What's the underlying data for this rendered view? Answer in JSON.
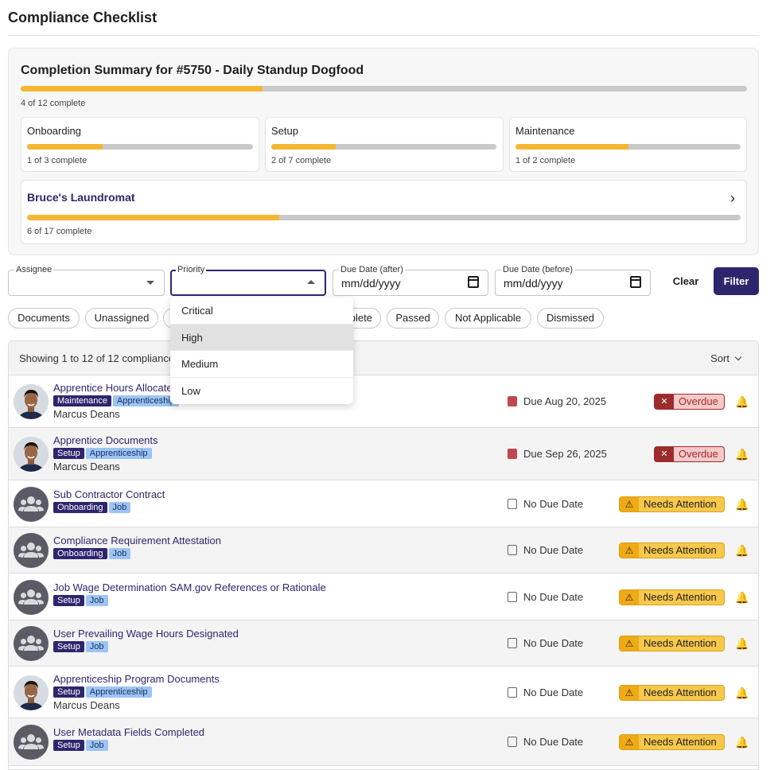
{
  "page_title": "Compliance Checklist",
  "summary": {
    "title": "Completion Summary for #5750 - Daily Standup Dogfood",
    "overall_progress": 0.333,
    "overall_text": "4 of 12 complete",
    "categories": [
      {
        "label": "Onboarding",
        "progress": 0.333,
        "text": "1 of 3 complete"
      },
      {
        "label": "Setup",
        "progress": 0.286,
        "text": "2 of 7 complete"
      },
      {
        "label": "Maintenance",
        "progress": 0.5,
        "text": "1 of 2 complete"
      }
    ],
    "site": {
      "name": "Bruce's Laundromat",
      "progress": 0.353,
      "text": "6 of 17 complete"
    }
  },
  "filters": {
    "assignee_label": "Assignee",
    "assignee_value": "",
    "priority_label": "Priority",
    "priority_value": "",
    "due_after_label": "Due Date (after)",
    "due_after_value": "mm/dd/yyyy",
    "due_before_label": "Due Date (before)",
    "due_before_value": "mm/dd/yyyy",
    "clear_label": "Clear",
    "filter_label": "Filter"
  },
  "priority_options": [
    "Critical",
    "High",
    "Medium",
    "Low"
  ],
  "priority_highlighted": "High",
  "chips": [
    "Documents",
    "Unassigned",
    "plete",
    "Passed",
    "Not Applicable",
    "Dismissed"
  ],
  "list": {
    "showing_text": "Showing 1 to 12 of 12 compliance",
    "sort_label": "Sort",
    "rows": [
      {
        "title": "Apprentice Hours Allocate",
        "category": "Maintenance",
        "type": "Apprenticeship",
        "assignee": "Marcus Deans",
        "due": "Due Aug 20, 2025",
        "status": "Overdue",
        "avatar": "person"
      },
      {
        "title": "Apprentice Documents",
        "category": "Setup",
        "type": "Apprenticeship",
        "assignee": "Marcus Deans",
        "due": "Due Sep 26, 2025",
        "status": "Overdue",
        "avatar": "person"
      },
      {
        "title": "Sub Contractor Contract",
        "category": "Onboarding",
        "type": "Job",
        "assignee": "",
        "due": "No Due Date",
        "status": "Needs Attention",
        "avatar": "group"
      },
      {
        "title": "Compliance Requirement Attestation",
        "category": "Onboarding",
        "type": "Job",
        "assignee": "",
        "due": "No Due Date",
        "status": "Needs Attention",
        "avatar": "group"
      },
      {
        "title": "Job Wage Determination SAM.gov References or Rationale",
        "category": "Setup",
        "type": "Job",
        "assignee": "",
        "due": "No Due Date",
        "status": "Needs Attention",
        "avatar": "group"
      },
      {
        "title": "User Prevailing Wage Hours Designated",
        "category": "Setup",
        "type": "Job",
        "assignee": "",
        "due": "No Due Date",
        "status": "Needs Attention",
        "avatar": "group"
      },
      {
        "title": "Apprenticeship Program Documents",
        "category": "Setup",
        "type": "Apprenticeship",
        "assignee": "Marcus Deans",
        "due": "No Due Date",
        "status": "Needs Attention",
        "avatar": "person"
      },
      {
        "title": "User Metadata Fields Completed",
        "category": "Setup",
        "type": "Job",
        "assignee": "",
        "due": "No Due Date",
        "status": "Needs Attention",
        "avatar": "group"
      }
    ]
  },
  "colors": {
    "brand": "#2e266d",
    "progress": "#f5b731",
    "overdue": "#9c2b2b",
    "needs_attention": "#f8c84b"
  }
}
